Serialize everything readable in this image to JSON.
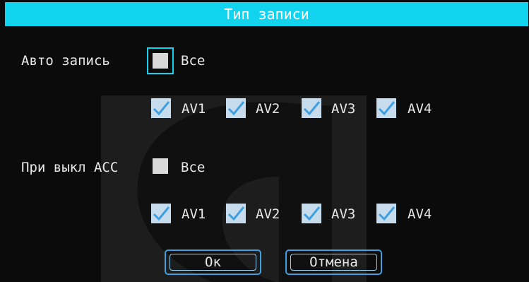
{
  "window": {
    "title": "Тип записи"
  },
  "auto_record": {
    "label": "Авто запись",
    "all_label": "Все",
    "all_checked": false,
    "channels": [
      {
        "label": "AV1",
        "checked": true
      },
      {
        "label": "AV2",
        "checked": true
      },
      {
        "label": "AV3",
        "checked": true
      },
      {
        "label": "AV4",
        "checked": true
      }
    ]
  },
  "acc_off_record": {
    "label": "При выкл ACC",
    "all_label": "Все",
    "all_checked": false,
    "channels": [
      {
        "label": "AV1",
        "checked": true
      },
      {
        "label": "AV2",
        "checked": true
      },
      {
        "label": "AV3",
        "checked": true
      },
      {
        "label": "AV4",
        "checked": true
      }
    ]
  },
  "buttons": {
    "ok_label": "Ок",
    "cancel_label": "Отмена"
  },
  "colors": {
    "accent": "#13d4ee",
    "background": "#0b0b0b",
    "checkbox": "#d9d9d9",
    "button_border": "#3fa0e0"
  },
  "icons": {
    "checkmark": "checkmark-icon",
    "background_logo": "logo-watermark-icon"
  }
}
